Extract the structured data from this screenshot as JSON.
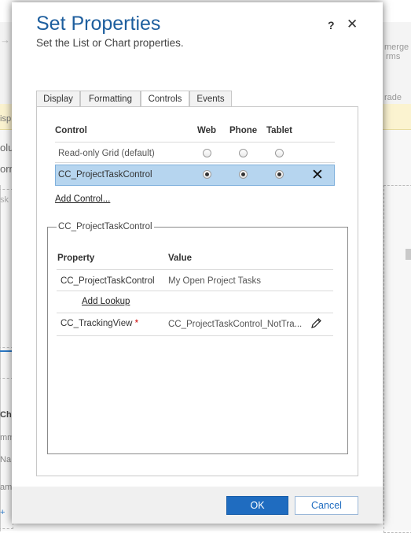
{
  "background": {
    "texts": [
      "isp",
      "olu",
      "orm",
      "sk",
      "merge",
      "rms",
      "rade",
      "Cha",
      "mm",
      "Na",
      "am",
      "+"
    ]
  },
  "dialog": {
    "title": "Set Properties",
    "subtitle": "Set the List or Chart properties.",
    "help_label": "?",
    "close_label": "✕",
    "tabs": [
      {
        "label": "Display",
        "active": false
      },
      {
        "label": "Formatting",
        "active": false
      },
      {
        "label": "Controls",
        "active": true
      },
      {
        "label": "Events",
        "active": false
      }
    ],
    "controls_table": {
      "headers": [
        "Control",
        "Web",
        "Phone",
        "Tablet"
      ],
      "rows": [
        {
          "name": "Read-only Grid (default)",
          "web": false,
          "phone": false,
          "tablet": false,
          "selected": false
        },
        {
          "name": "CC_ProjectTaskControl",
          "web": true,
          "phone": true,
          "tablet": true,
          "selected": true
        }
      ],
      "remove_label": "✕"
    },
    "add_control_label": "Add Control...",
    "control_properties": {
      "legend": "CC_ProjectTaskControl",
      "headers": [
        "Property",
        "Value"
      ],
      "rows": [
        {
          "property": "CC_ProjectTaskControl",
          "value": "My Open Project Tasks",
          "required": false
        },
        {
          "property": "CC_TrackingView",
          "value": "CC_ProjectTaskControl_NotTra...",
          "required": true
        }
      ],
      "required_marker": "*",
      "add_lookup_label": "Add Lookup",
      "edit_icon": "pencil-icon"
    },
    "ok_label": "OK",
    "cancel_label": "Cancel"
  },
  "colors": {
    "title": "#1d5e9e",
    "selected_row": "#b6d5ef",
    "primary_button": "#1f6cc0",
    "required": "#cc0000"
  }
}
